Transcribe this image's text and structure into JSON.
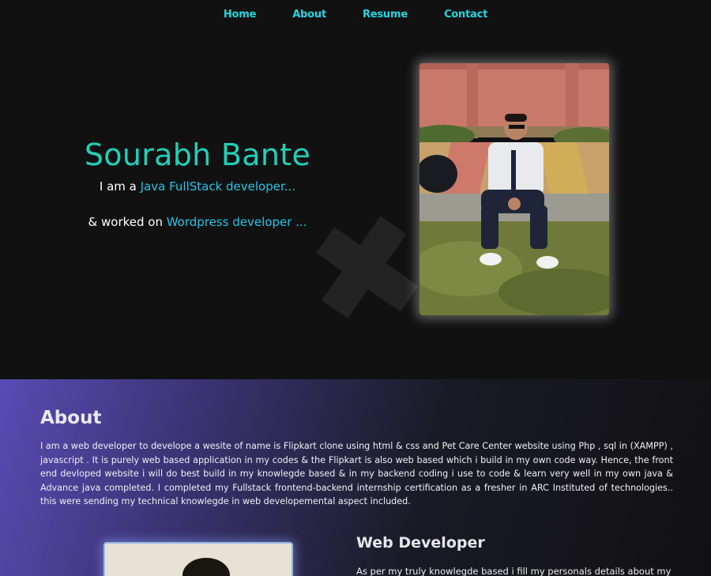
{
  "nav": {
    "items": [
      {
        "label": "Home"
      },
      {
        "label": "About"
      },
      {
        "label": "Resume"
      },
      {
        "label": "Contact"
      }
    ]
  },
  "hero": {
    "name": "Sourabh Bante",
    "line1_prefix": "I am a ",
    "line1_highlight": "Java FullStack developer...",
    "line2_prefix": "& worked on ",
    "line2_highlight": "Wordpress developer ..."
  },
  "about": {
    "heading": "About",
    "text": "I am a web developer to develope a wesite of name is Flipkart clone using html & css and Pet Care Center website using Php , sql in (XAMPP) , javascript . It is purely web based application in my codes & the Flipkart is also web based which i build in my own code way. Hence, the front end devloped website i will do best build in my knowlegde based & in my backend coding i use to code & learn very well in my own java & Advance java completed. I completed my Fullstack frontend-backend internship certification as a fresher in ARC Instituted of technologies.. this were sending my technical knowlegde in web developemental aspect included.",
    "subheading": "Web Developer",
    "subtext": "As per my truly knowlegde based i fill my personals details about my"
  },
  "colors": {
    "accent_nav": "#1ed8e0",
    "name": "#1ed1b8",
    "highlight": "#1fc5e6",
    "background": "#111112"
  }
}
